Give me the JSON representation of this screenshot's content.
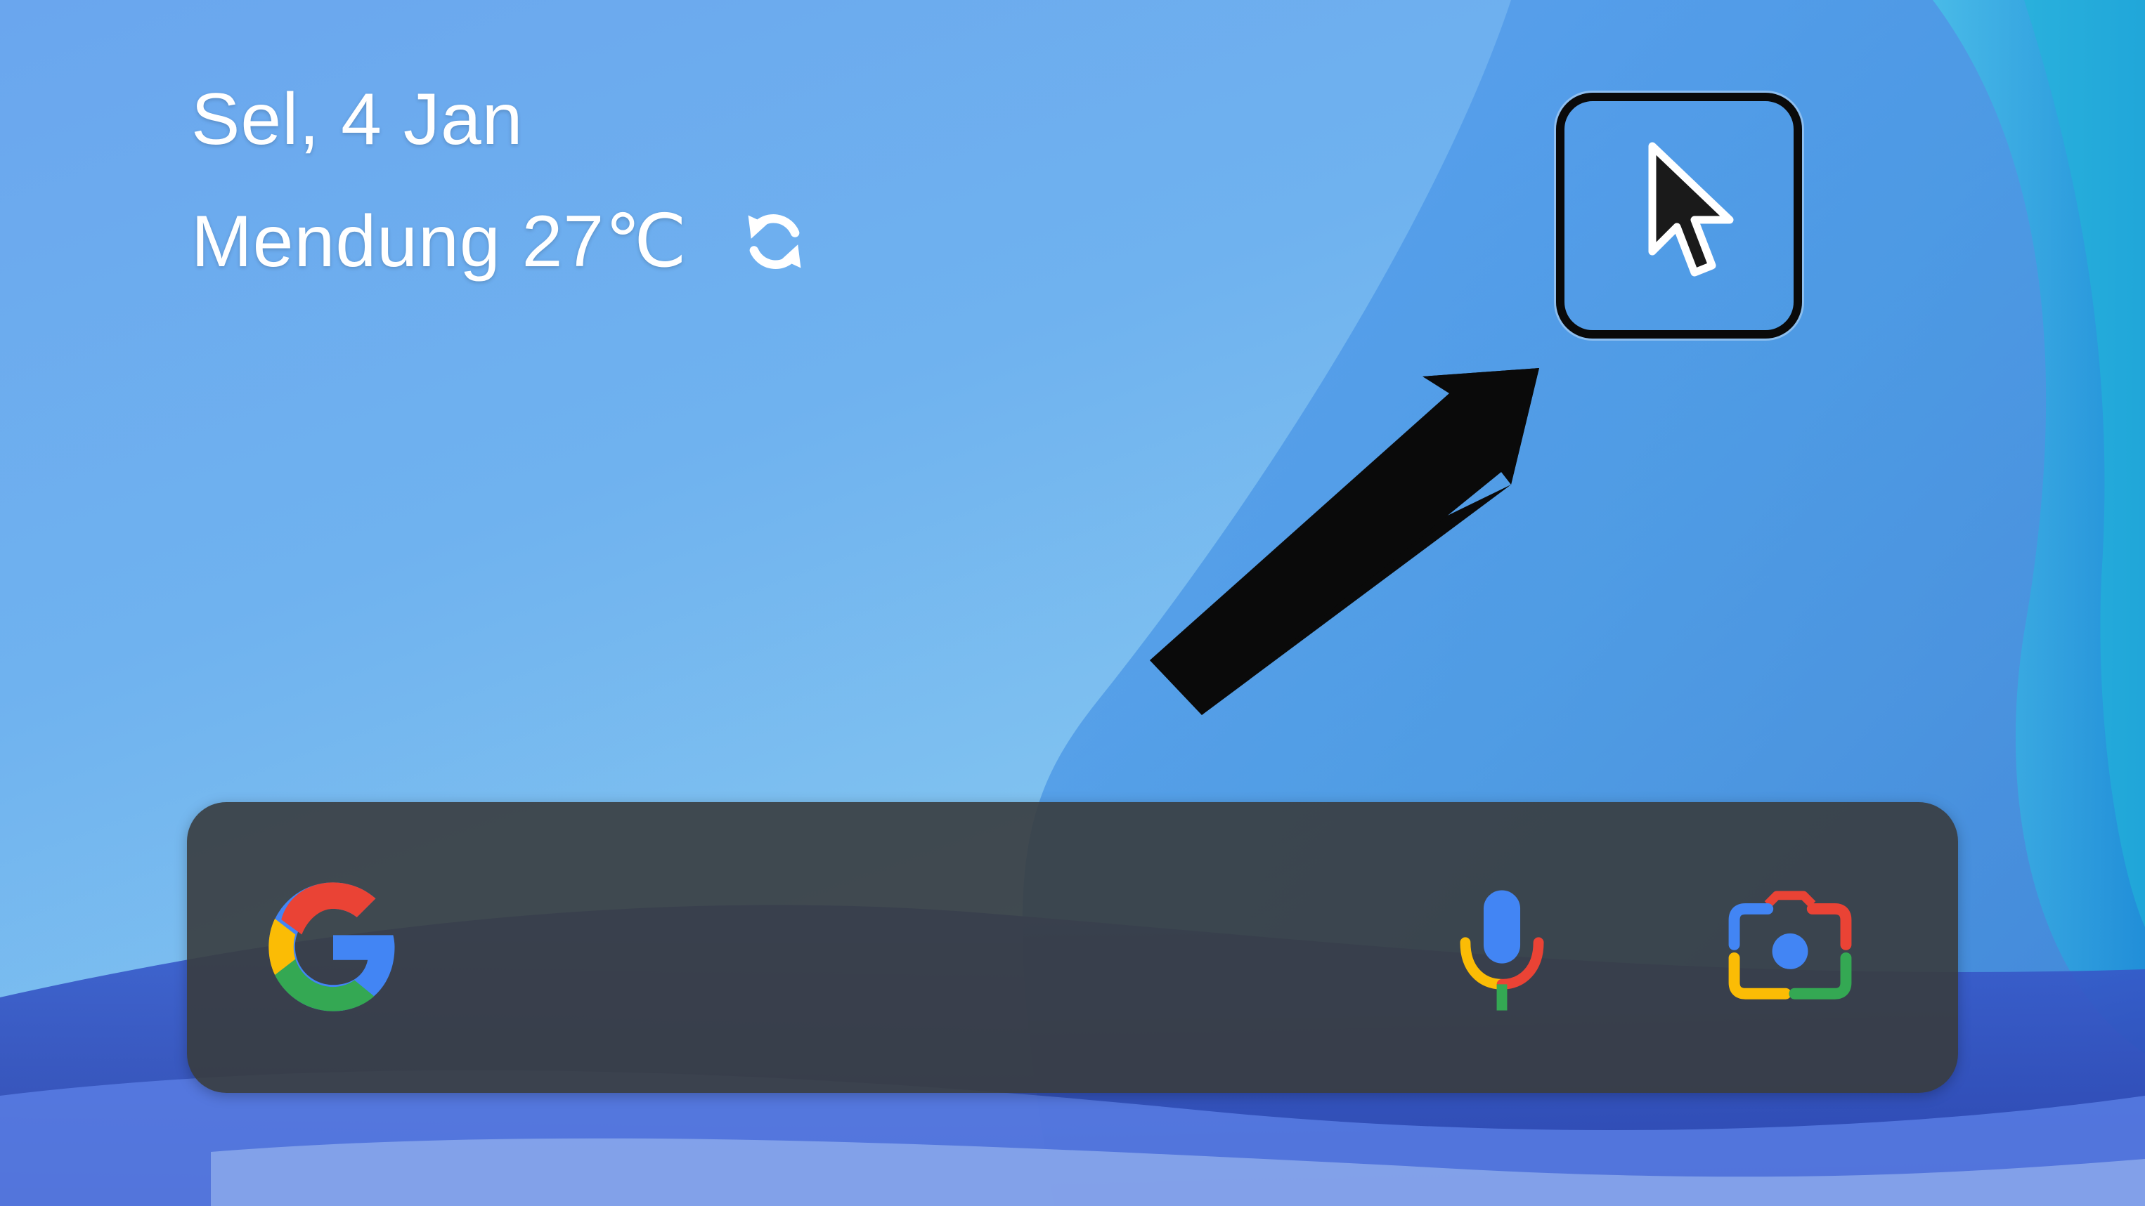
{
  "widget": {
    "date": "Sel, 4 Jan",
    "weather": "Mendung 27℃"
  },
  "icons": {
    "refresh": "refresh-icon",
    "cursor": "mouse-pointer-icon",
    "google": "google-g-logo",
    "mic": "microphone-icon",
    "lens": "google-lens-camera-icon"
  },
  "colors": {
    "google_blue": "#4285F4",
    "google_red": "#EA4335",
    "google_yellow": "#FBBC05",
    "google_green": "#34A853",
    "search_bar": "#383c3e",
    "annotation": "#0a0a0a"
  }
}
